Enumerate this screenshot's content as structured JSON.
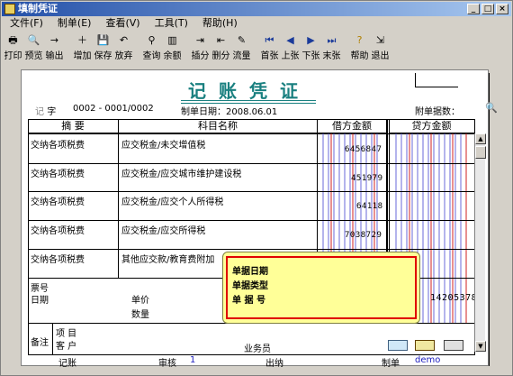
{
  "window": {
    "title": "填制凭证"
  },
  "menu": [
    "文件(F)",
    "制单(E)",
    "查看(V)",
    "工具(T)",
    "帮助(H)"
  ],
  "toolbar": [
    "打印",
    "预览",
    "输出",
    "增加",
    "保存",
    "放弃",
    "查询",
    "余额",
    "插分",
    "删分",
    "流量",
    "首张",
    "上张",
    "下张",
    "末张",
    "帮助",
    "退出"
  ],
  "voucher": {
    "title": "记账凭证",
    "type_char": "记",
    "type_label": "字",
    "number": "0002 - 0001/0002",
    "date_label": "制单日期：2008.06.01",
    "attach_label": "附单据数："
  },
  "columns": {
    "summary": "摘 要",
    "account": "科目名称",
    "debit": "借方金额",
    "credit": "贷方金额"
  },
  "rows": [
    {
      "summary": "交纳各项税费",
      "account": "应交税金/未交增值税",
      "debit": "6456847"
    },
    {
      "summary": "交纳各项税费",
      "account": "应交税金/应交城市维护建设税",
      "debit": "451979"
    },
    {
      "summary": "交纳各项税费",
      "account": "应交税金/应交个人所得税",
      "debit": "64118"
    },
    {
      "summary": "交纳各项税费",
      "account": "应交税金/应交所得税",
      "debit": "7038729"
    },
    {
      "summary": "交纳各项税费",
      "account": "其他应交款/教育费附加"
    }
  ],
  "totals": {
    "bill_no": "票号",
    "date": "日期",
    "unit_price": "单价",
    "qty": "数量",
    "total_right": "14205378"
  },
  "remarks": {
    "label": "备注",
    "project": "项 目",
    "customer": "客 户",
    "salesman": "业务员"
  },
  "popup": {
    "line1": "单据日期",
    "line2": "单据类型",
    "line3": "单 据 号"
  },
  "footer": {
    "bookkeeping": "记账",
    "audit": "审核",
    "audit_val": "1",
    "cashier": "出纳",
    "maker": "制单",
    "maker_val": "demo"
  }
}
